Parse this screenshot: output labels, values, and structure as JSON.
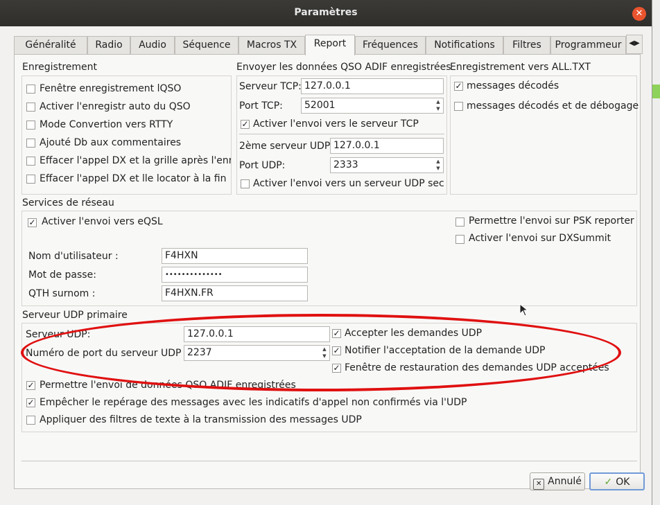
{
  "window": {
    "title": "Paramètres",
    "close_glyph": "✕"
  },
  "tabs": [
    "Généralité",
    "Radio",
    "Audio",
    "Séquence",
    "Macros TX",
    "Report",
    "Fréquences",
    "Notifications",
    "Filtres",
    "Programmeur"
  ],
  "tab_scroll": "◀▶",
  "logging": {
    "title": "Enregistrement",
    "items": [
      {
        "label": "Fenêtre enregistrement lQSO",
        "checked": false
      },
      {
        "label": "Activer l'enregistr auto du QSO",
        "checked": false
      },
      {
        "label": "Mode Convertion vers RTTY",
        "checked": false
      },
      {
        "label": "Ajouté Db aux commentaires",
        "checked": false
      },
      {
        "label": "Effacer l'appel DX et la grille après l'enre",
        "checked": false
      },
      {
        "label": "Effacer l'appel DX et lle locator à la fin",
        "checked": false
      }
    ]
  },
  "adif": {
    "title": "Envoyer les données QSO ADIF enregistrées",
    "tcp_server_label": "Serveur TCP:",
    "tcp_server_value": "127.0.0.1",
    "tcp_port_label": "Port TCP:",
    "tcp_port_value": "52001",
    "tcp_enable_label": "Activer l'envoi vers le serveur TCP",
    "tcp_enable_checked": true,
    "udp2_label": "2ème serveur UDP",
    "udp2_value": "127.0.0.1",
    "udp_port_label": "Port UDP:",
    "udp_port_value": "2333",
    "udp_enable_label": "Activer l'envoi vers un serveur UDP secor",
    "udp_enable_checked": false
  },
  "alltxt": {
    "title": "Enregistrement vers ALL.TXT",
    "items": [
      {
        "label": "messages décodés",
        "checked": true
      },
      {
        "label": "messages décodés et de débogage",
        "checked": false
      }
    ]
  },
  "network": {
    "title": "Services de réseau",
    "eqsl_label": "Activer l'envoi vers eQSL",
    "eqsl_checked": true,
    "psk_label": "Permettre l'envoi sur PSK reporter",
    "psk_checked": false,
    "dxsummit_label": "Activer l'envoi sur DXSummit",
    "dxsummit_checked": false,
    "user_label": "Nom d'utilisateur :",
    "user_value": "F4HXN",
    "pass_label": "Mot de passe:",
    "pass_value": "••••••••••••••",
    "qth_label": "QTH surnom :",
    "qth_value": "F4HXN.FR"
  },
  "udp_primary": {
    "title": "Serveur UDP primaire",
    "server_label": "Serveur UDP:",
    "server_value": "127.0.0.1",
    "port_label": "Numéro de port du serveur UDP :",
    "port_value": "2237",
    "accept_label": "Accepter les demandes UDP",
    "accept_checked": true,
    "notify_label": "Notifier l'acceptation de la demande UDP",
    "notify_checked": true,
    "restore_label": "Fenêtre de restauration des demandes UDP acceptées",
    "restore_checked": true,
    "adif_label": "Permettre l'envoi de données QSO ADIF enregistrées",
    "adif_checked": true,
    "prevent_label": "Empêcher le repérage des messages avec les indicatifs d'appel non confirmés via l'UDP",
    "prevent_checked": true,
    "filters_label": "Appliquer des filtres de texte à la transmission des messages UDP",
    "filters_checked": false
  },
  "buttons": {
    "cancel": "Annulé",
    "ok": "OK"
  },
  "background": {
    "partial_text": "x"
  },
  "colors": {
    "title_bar": "#302f2c",
    "close": "#e9542e",
    "annotation_ellipse": "#e01010",
    "ok_border": "#6f9ad7"
  }
}
